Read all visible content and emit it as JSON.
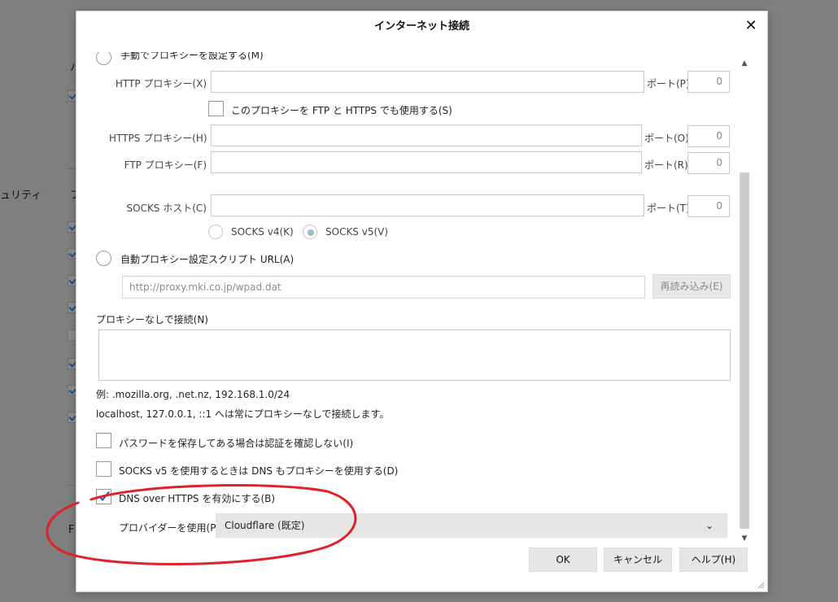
{
  "background": {
    "label_security": "ュリティ",
    "label_F": "F"
  },
  "dialog": {
    "title": "インターネット接続",
    "manual_proxy_label": "手動でプロキシーを設定する(M)",
    "http_proxy_label": "HTTP プロキシー(X)",
    "http_port_label": "ポート(P)",
    "http_port_value": "0",
    "use_for_ftp_https_label": "このプロキシーを FTP と HTTPS でも使用する(S)",
    "https_proxy_label": "HTTPS プロキシー(H)",
    "https_port_label": "ポート(O)",
    "https_port_value": "0",
    "ftp_proxy_label": "FTP プロキシー(F)",
    "ftp_port_label": "ポート(R)",
    "ftp_port_value": "0",
    "socks_host_label": "SOCKS ホスト(C)",
    "socks_port_label": "ポート(T)",
    "socks_port_value": "0",
    "socks_v4_label": "SOCKS v4(K)",
    "socks_v5_label": "SOCKS v5(V)",
    "auto_proxy_label": "自動プロキシー設定スクリプト URL(A)",
    "auto_proxy_url": "http://proxy.mki.co.jp/wpad.dat",
    "reload_label": "再読み込み(E)",
    "no_proxy_label": "プロキシーなしで接続(N)",
    "no_proxy_example": "例: .mozilla.org, .net.nz, 192.168.1.0/24",
    "no_proxy_note": "localhost, 127.0.0.1, ::1 へは常にプロキシーなしで接続します。",
    "no_auth_prompt_label": "パスワードを保存してある場合は認証を確認しない(I)",
    "socks_dns_label": "SOCKS v5 を使用するときは DNS もプロキシーを使用する(D)",
    "doh_label": "DNS over HTTPS を有効にする(B)",
    "provider_label": "プロバイダーを使用(P)",
    "provider_value": "Cloudflare (既定)",
    "ok_label": "OK",
    "cancel_label": "キャンセル",
    "help_label": "ヘルプ(H)"
  },
  "state": {
    "manual_proxy_selected": false,
    "use_for_ftp_https_checked": false,
    "socks_version": "v5",
    "auto_proxy_selected": false,
    "no_auth_prompt_checked": false,
    "socks_dns_checked": false,
    "doh_checked": true
  },
  "colors": {
    "annotation": "#e0202a",
    "radio_selected": "#8ebfe0",
    "checkmark": "#1c5fa8"
  }
}
